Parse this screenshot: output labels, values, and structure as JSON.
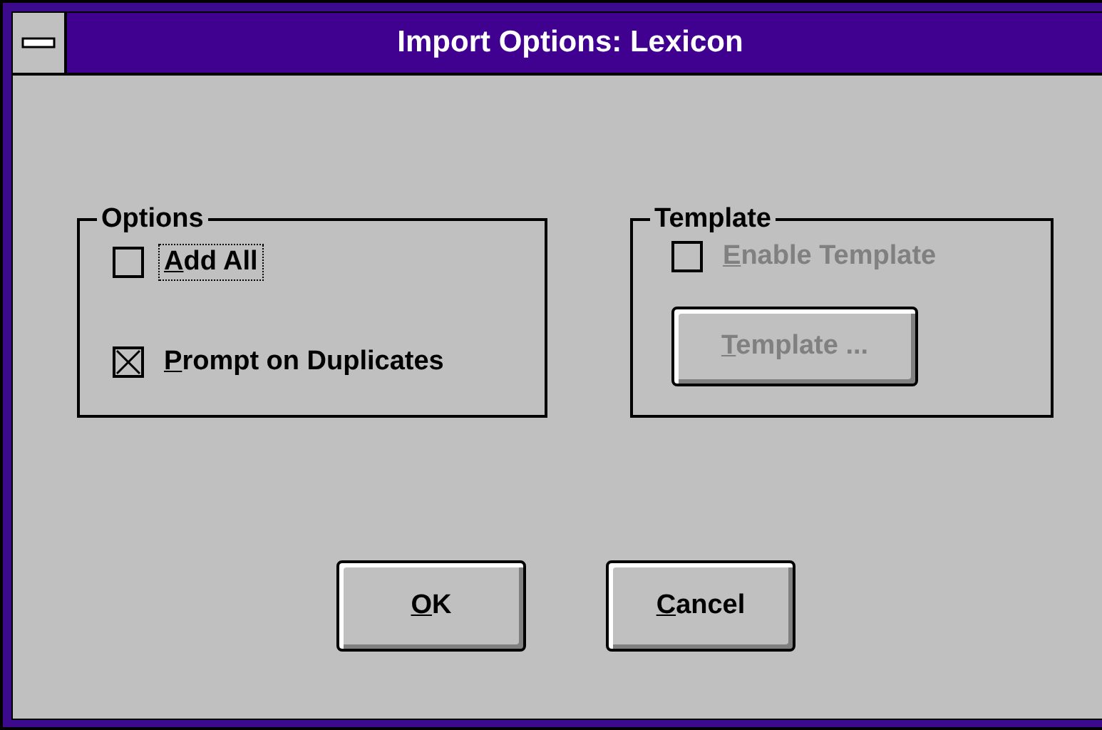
{
  "window": {
    "title": "Import Options: Lexicon"
  },
  "groups": [
    {
      "title": "Options",
      "items": [
        {
          "kind": "checkbox",
          "label": "Add All",
          "checked": false,
          "disabled": false,
          "focused": true
        },
        {
          "kind": "checkbox",
          "label": "Prompt on Duplicates",
          "checked": true,
          "disabled": false,
          "focused": false
        }
      ]
    },
    {
      "title": "Template",
      "items": [
        {
          "kind": "checkbox",
          "label": "Enable Template",
          "checked": false,
          "disabled": true,
          "focused": false
        },
        {
          "kind": "button",
          "label": "Template ...",
          "disabled": true
        }
      ]
    }
  ],
  "buttons": [
    {
      "label": "OK",
      "disabled": false
    },
    {
      "label": "Cancel",
      "disabled": false
    }
  ]
}
